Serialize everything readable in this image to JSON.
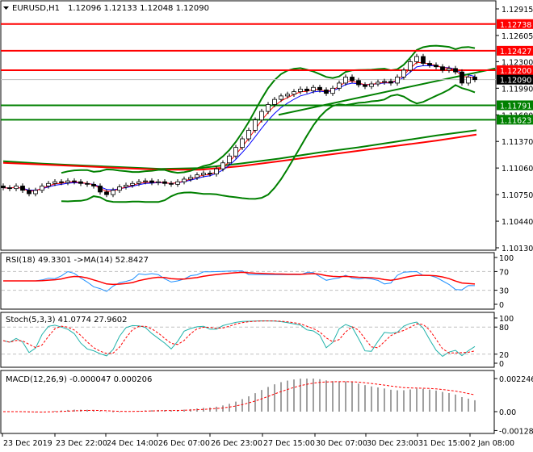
{
  "chart_data": {
    "type": "candlestick",
    "symbol_header": "EURUSD,H1",
    "ohlc_header": "1.12096 1.12133 1.12048 1.12090",
    "ylim": [
      1.1013,
      1.12915
    ],
    "price_ticks": [
      "1.12915",
      "1.12605",
      "1.12300",
      "1.11990",
      "1.11680",
      "1.11370",
      "1.11060",
      "1.10750",
      "1.10440",
      "1.10130"
    ],
    "levels": [
      {
        "value": 1.12738,
        "label": "1.12738",
        "color": "#ff0000"
      },
      {
        "value": 1.12427,
        "label": "1.12427",
        "color": "#ff0000"
      },
      {
        "value": 1.122,
        "label": "1.12200",
        "color": "#ff0000"
      },
      {
        "value": 1.1209,
        "label": "1.12090",
        "color": "#000000",
        "bid": true
      },
      {
        "value": 1.11791,
        "label": "1.11791",
        "color": "#008000"
      },
      {
        "value": 1.11623,
        "label": "1.11623",
        "color": "#008000"
      }
    ],
    "closes": [
      1.1083,
      1.1082,
      1.1085,
      1.108,
      1.1076,
      1.108,
      1.1085,
      1.1088,
      1.109,
      1.1089,
      1.1091,
      1.109,
      1.1088,
      1.1087,
      1.1085,
      1.1078,
      1.1075,
      1.108,
      1.1084,
      1.1086,
      1.1088,
      1.109,
      1.1091,
      1.1089,
      1.109,
      1.1088,
      1.1087,
      1.109,
      1.1093,
      1.1095,
      1.1098,
      1.11,
      1.1099,
      1.1105,
      1.1112,
      1.112,
      1.113,
      1.114,
      1.115,
      1.1162,
      1.1172,
      1.118,
      1.1186,
      1.119,
      1.1192,
      1.1195,
      1.1198,
      1.1196,
      1.12,
      1.1197,
      1.1193,
      1.1199,
      1.1205,
      1.1212,
      1.1208,
      1.1203,
      1.1201,
      1.1204,
      1.1206,
      1.1207,
      1.1205,
      1.1212,
      1.122,
      1.123,
      1.1236,
      1.1228,
      1.1226,
      1.1224,
      1.122,
      1.1222,
      1.1218,
      1.1205,
      1.1212,
      1.1209
    ],
    "slow_ma_red": [
      1.1112,
      1.111,
      1.1108,
      1.1106,
      1.1104,
      1.1104,
      1.1108,
      1.1114,
      1.112,
      1.1126,
      1.1132,
      1.1138,
      1.1145
    ],
    "slow_ma_green": [
      1.1114,
      1.1111,
      1.1109,
      1.1107,
      1.1105,
      1.1106,
      1.1111,
      1.1117,
      1.1124,
      1.113,
      1.1137,
      1.1144,
      1.115
    ],
    "trendline": [
      1.1168,
      1.1222
    ],
    "time_labels": [
      "23 Dec 2019",
      "23 Dec 22:00",
      "24 Dec 14:00",
      "26 Dec 07:00",
      "26 Dec 23:00",
      "27 Dec 15:00",
      "30 Dec 07:00",
      "30 Dec 23:00",
      "31 Dec 15:00",
      "2 Jan 08:00"
    ],
    "rsi": {
      "label": "RSI(18) 49.3301  ->MA(14) 52.8427",
      "period": 18,
      "ma": 14,
      "ticks": [
        "100",
        "70",
        "30",
        "0"
      ],
      "levels": [
        70,
        30
      ]
    },
    "stoch": {
      "label": "Stoch(5,3,3) 41.0774 27.9602",
      "k": 5,
      "d": 3,
      "slow": 3,
      "ticks": [
        "100",
        "80",
        "20",
        "0"
      ],
      "levels": [
        80,
        20
      ]
    },
    "macd": {
      "label": "MACD(12,26,9) -0.000047 0.000206",
      "fast": 12,
      "slow": 26,
      "signal": 9,
      "ticks": [
        "0.002246",
        "0.00",
        "-0.001284"
      ],
      "range": [
        -0.001284,
        0.002246
      ]
    }
  }
}
